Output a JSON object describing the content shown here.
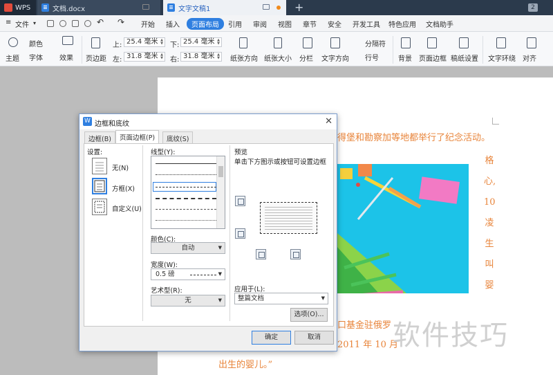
{
  "titlebar": {
    "app_tab": "WPS",
    "tabs": [
      {
        "label": "文档.docx"
      },
      {
        "label": "文字文稿1"
      }
    ],
    "new_tab": "+",
    "window_count": "2"
  },
  "menubar": {
    "file": "文件",
    "items": [
      "开始",
      "插入",
      "页面布局",
      "引用",
      "审阅",
      "视图",
      "章节",
      "安全",
      "开发工具",
      "特色应用",
      "文档助手"
    ],
    "active_index": 2
  },
  "ribbon": {
    "theme": "主题",
    "colors": "颜色",
    "fonts": "字体",
    "effects": "效果",
    "margins": "页边距",
    "top_label": "上:",
    "top_value": "25.4 毫米",
    "bottom_label": "下:",
    "bottom_value": "25.4 毫米",
    "left_label": "左:",
    "left_value": "31.8 毫米",
    "right_label": "右:",
    "right_value": "31.8 毫米",
    "orientation": "纸张方向",
    "size": "纸张大小",
    "columns": "分栏",
    "text_direction": "文字方向",
    "breaks": "分隔符",
    "line_numbers": "行号",
    "background": "背景",
    "page_border": "页面边框",
    "manuscript": "稿纸设置",
    "wrap": "文字环绕",
    "align": "对齐"
  },
  "document": {
    "line1": "得堡和勘察加等地都举行了纪念活动。",
    "vertical": [
      "格",
      "心,",
      "10",
      "凌",
      "生",
      "叫",
      "婴"
    ],
    "line_fund": "口基金驻俄罗",
    "line_date": "2011 年 10 月",
    "line_last": "出生的婴儿。”",
    "watermark": "软件技巧"
  },
  "dialog": {
    "title": "边框和底纹",
    "close": "✕",
    "tabs": [
      "边框(B)",
      "页面边框(P)",
      "底纹(S)"
    ],
    "active_tab": 1,
    "setting_label": "设置:",
    "settings": [
      "无(N)",
      "方框(X)",
      "自定义(U)"
    ],
    "selected_setting": 1,
    "style_label": "线型(Y):",
    "color_label": "颜色(C):",
    "color_value": "自动",
    "width_label": "宽度(W):",
    "width_value": "0.5 磅",
    "art_label": "艺术型(R):",
    "art_value": "无",
    "preview_label": "预览",
    "preview_hint": "单击下方图示或按钮可设置边框",
    "apply_label": "应用于(L):",
    "apply_value": "整篇文档",
    "options_button": "选项(O)...",
    "ok_button": "确定",
    "cancel_button": "取消"
  },
  "colors": {
    "accent": "#2f7fe0",
    "doc_text": "#e8843a",
    "titlebar": "#2b3a4c"
  }
}
